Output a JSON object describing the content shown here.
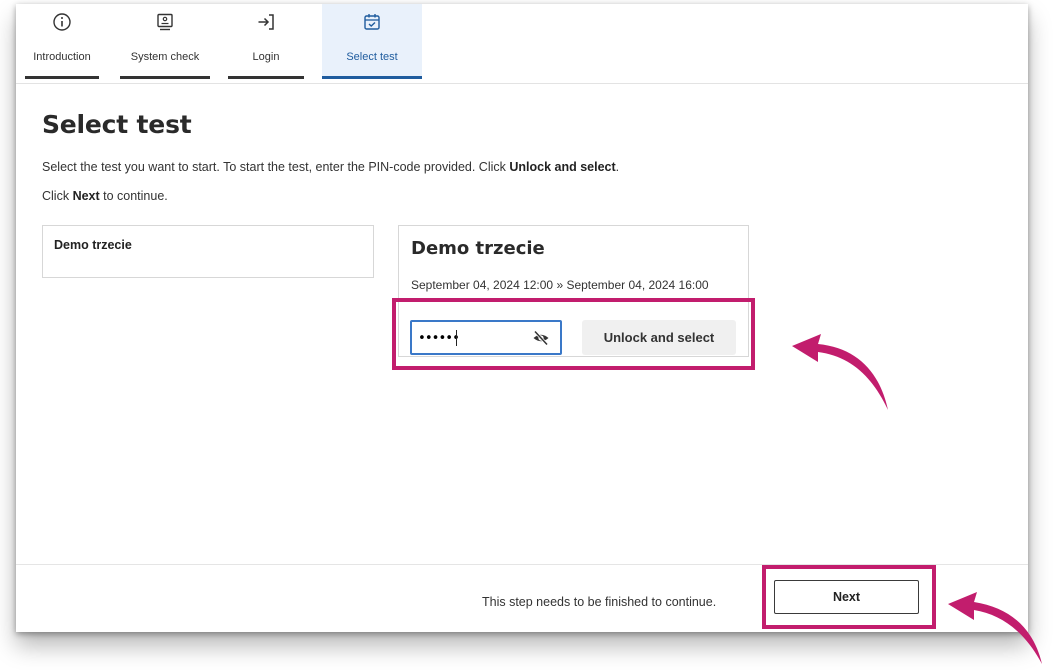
{
  "steps": [
    {
      "label": "Introduction",
      "icon": "info-icon"
    },
    {
      "label": "System check",
      "icon": "monitor-icon"
    },
    {
      "label": "Login",
      "icon": "login-icon"
    },
    {
      "label": "Select test",
      "icon": "calendar-check-icon"
    }
  ],
  "page": {
    "title": "Select test",
    "instruction_1_pre": "Select the test you want to start. To start the test, enter the PIN-code provided. Click ",
    "instruction_1_bold": "Unlock and select",
    "instruction_1_post": ".",
    "instruction_2_pre": "Click ",
    "instruction_2_bold": "Next",
    "instruction_2_post": " to continue."
  },
  "test_list": [
    {
      "name": "Demo trzecie"
    }
  ],
  "selected_test": {
    "name": "Demo trzecie",
    "dates": "September 04, 2024 12:00 » September 04, 2024 16:00",
    "pin_value": "••••••",
    "unlock_label": "Unlock and select"
  },
  "footer": {
    "message": "This step needs to be finished to continue.",
    "next_label": "Next"
  },
  "colors": {
    "accent": "#1f5c9e",
    "highlight": "#c21d6d",
    "active_tab_bg": "#e9f1fb"
  }
}
